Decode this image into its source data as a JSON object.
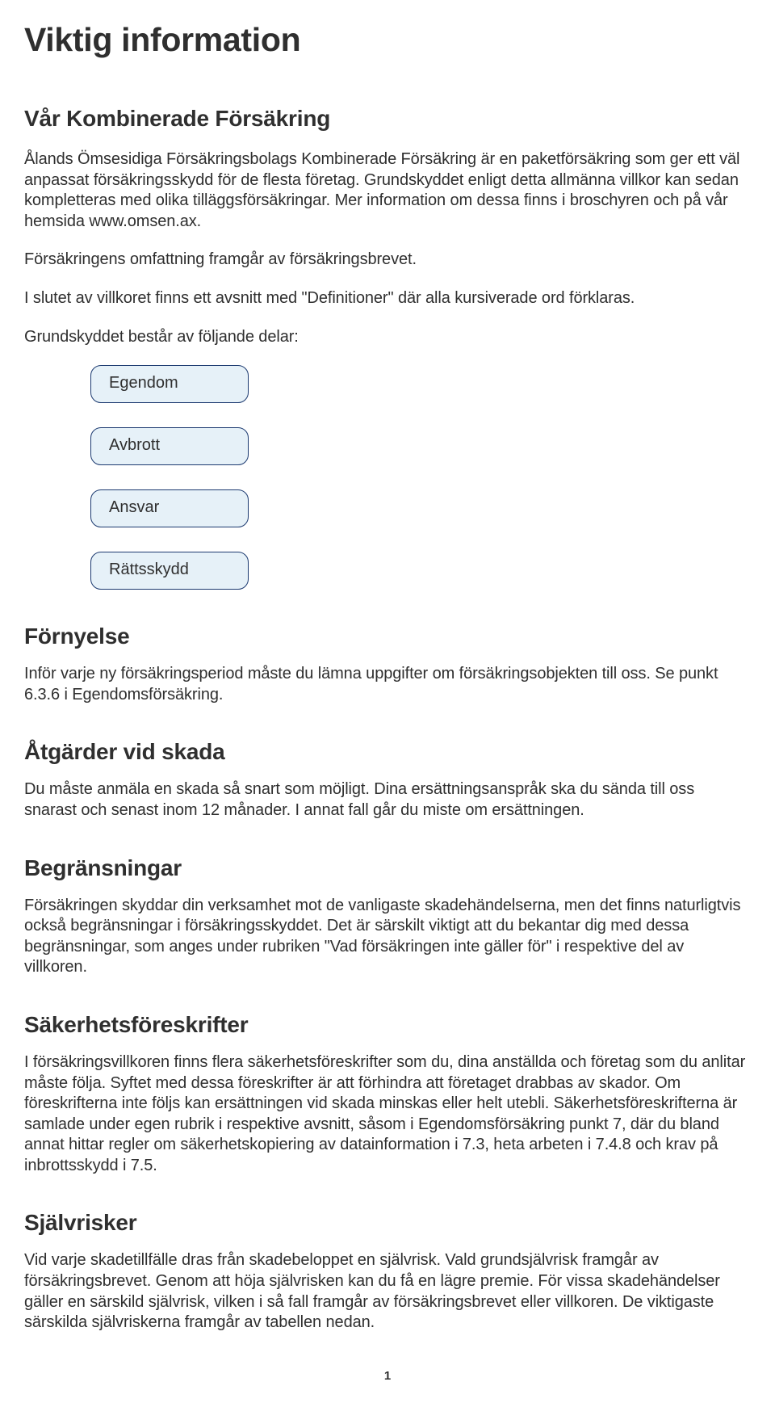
{
  "title": "Viktig information",
  "subtitle": "Vår Kombinerade Försäkring",
  "intro_p1": "Ålands Ömsesidiga Försäkringsbolags Kombinerade Försäkring är en paketförsäkring som ger ett väl anpassat försäkringsskydd för de flesta företag. Grundskyddet enligt detta allmänna villkor kan sedan kompletteras med olika tilläggsförsäkringar. Mer information om dessa finns i broschyren och på vår hemsida www.omsen.ax.",
  "intro_p2": "Försäkringens omfattning framgår av försäkringsbrevet.",
  "intro_p3": "I slutet av villkoret finns ett avsnitt med \"Definitioner\" där alla kursiverade ord förklaras.",
  "intro_p4": "Grundskyddet består av följande delar:",
  "parts": [
    "Egendom",
    "Avbrott",
    "Ansvar",
    "Rättsskydd"
  ],
  "sections": {
    "fornyelse": {
      "heading": "Förnyelse",
      "body": "Inför varje ny försäkringsperiod måste du lämna uppgifter om försäkringsobjekten till oss. Se punkt 6.3.6 i Egendomsförsäkring."
    },
    "atgarder": {
      "heading": "Åtgärder vid skada",
      "body": "Du måste anmäla en skada så snart som möjligt. Dina ersättningsanspråk ska du sända till oss snarast och senast inom 12 månader. I annat fall går du miste om ersättningen."
    },
    "begransningar": {
      "heading": "Begränsningar",
      "body": "Försäkringen skyddar din verksamhet mot de vanligaste skadehändelserna, men det finns naturligtvis också begränsningar i försäkringsskyddet. Det är särskilt viktigt att du bekantar dig med dessa begränsningar, som anges under rubriken \"Vad försäkringen inte gäller för\" i respektive del av villkoren."
    },
    "sakerhet": {
      "heading": "Säkerhetsföreskrifter",
      "body": "I försäkringsvillkoren finns flera säkerhetsföreskrifter som du, dina anställda och företag som du anlitar måste följa. Syftet med dessa föreskrifter är att förhindra att företaget drabbas av skador. Om föreskrifterna inte följs kan ersättningen vid skada minskas eller helt utebli. Säkerhetsföreskrifterna är samlade under egen rubrik i respektive avsnitt, såsom i Egendomsförsäkring punkt 7, där du bland annat hittar regler om säkerhetskopiering av datainformation i 7.3, heta arbeten i 7.4.8 och krav på inbrottsskydd i 7.5."
    },
    "sjalvrisker": {
      "heading": "Självrisker",
      "body": "Vid varje skadetillfälle dras från skadebeloppet en självrisk. Vald grundsjälvrisk framgår av försäkringsbrevet. Genom att höja självrisken kan du få en lägre premie. För vissa skadehändelser gäller en särskild självrisk, vilken i så fall framgår av försäkringsbrevet eller villkoren. De viktigaste särskilda självriskerna framgår av tabellen nedan."
    }
  },
  "page_number": "1"
}
